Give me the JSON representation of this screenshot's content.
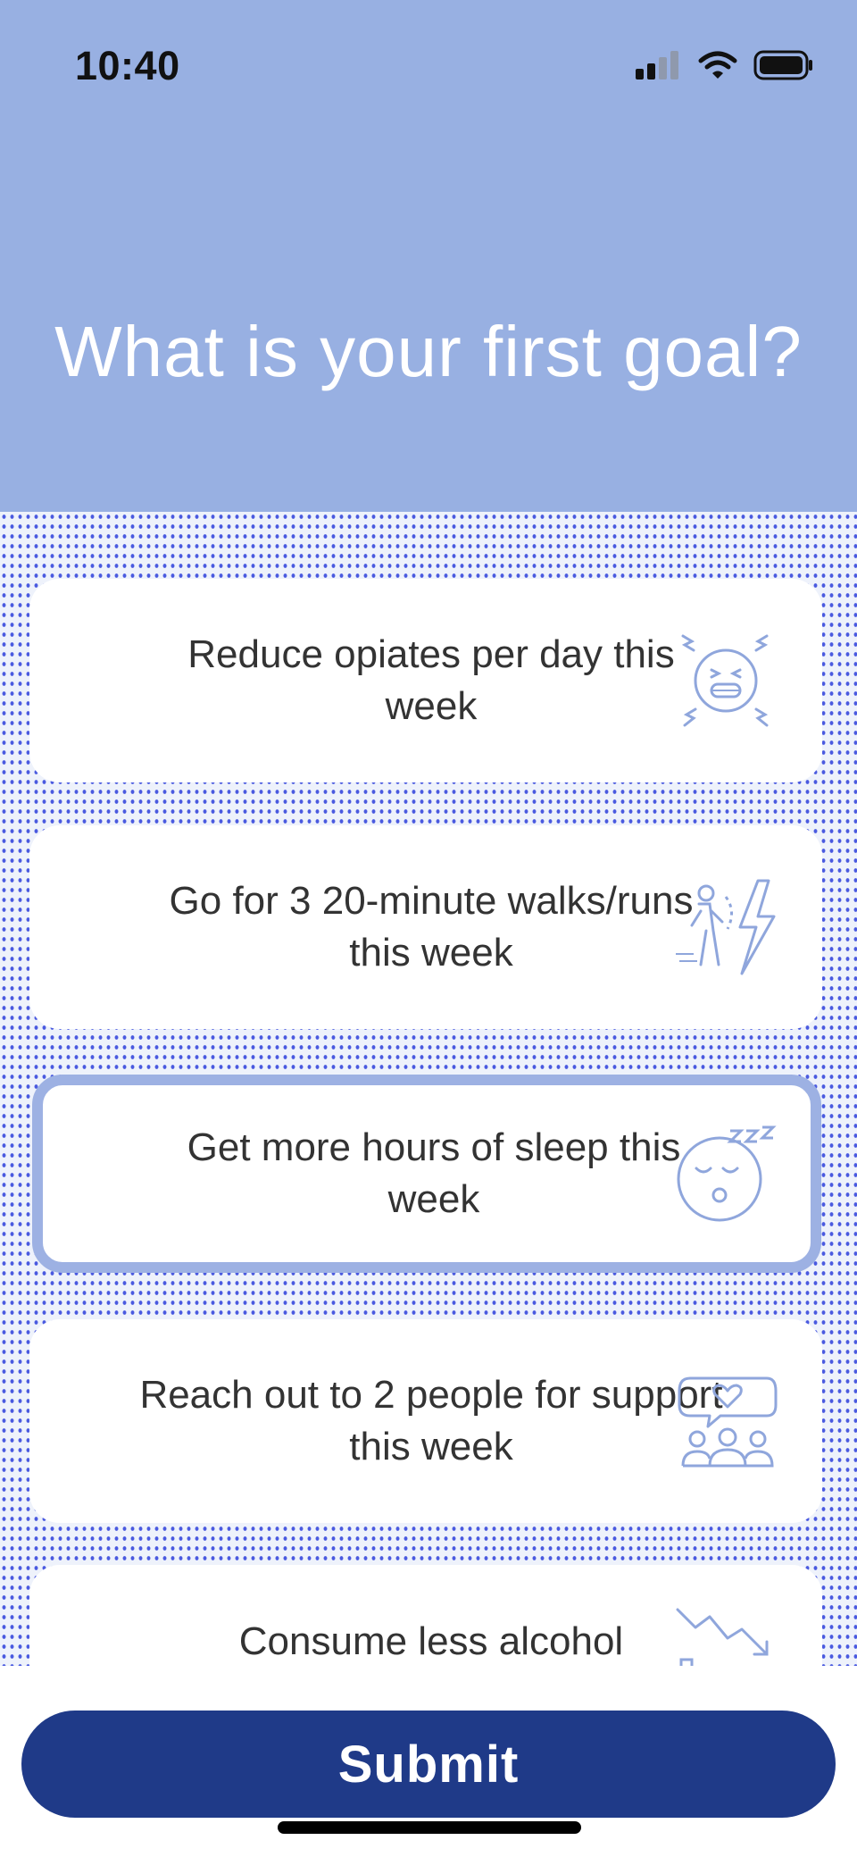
{
  "status_bar": {
    "time": "10:40"
  },
  "header": {
    "title": "What is your first goal?"
  },
  "goals": [
    {
      "label": "Reduce opiates per day this week",
      "icon": "stressed-face-icon",
      "selected": false
    },
    {
      "label": "Go for 3 20-minute walks/runs this week",
      "icon": "runner-energy-icon",
      "selected": false
    },
    {
      "label": "Get more hours of sleep this week",
      "icon": "sleeping-face-icon",
      "selected": true
    },
    {
      "label": "Reach out to 2 people for support this week",
      "icon": "support-group-icon",
      "selected": false
    },
    {
      "label": "Consume less alcohol",
      "icon": "decline-chart-icon",
      "selected": false
    }
  ],
  "submit": {
    "label": "Submit"
  },
  "colors": {
    "header_bg": "#98b0e2",
    "accent": "#1f3a88",
    "selected_border": "#9db1e3",
    "icon_stroke": "#8fa6dc"
  }
}
